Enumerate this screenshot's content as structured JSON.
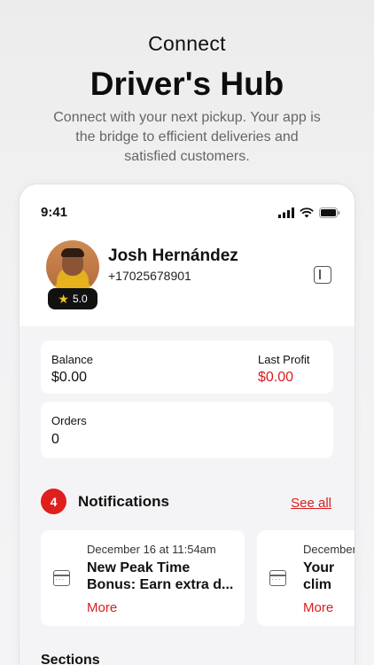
{
  "promo": {
    "eyebrow": "Connect",
    "title": "Driver's Hub",
    "subtitle": "Connect with your next pickup. Your app is the bridge to efficient deliveries and satisfied customers."
  },
  "status_bar": {
    "time": "9:41"
  },
  "profile": {
    "name": "Josh Hernández",
    "phone": "+17025678901",
    "rating": "5.0"
  },
  "stats": {
    "balance_label": "Balance",
    "balance_value": "$0.00",
    "last_profit_label": "Last Profit",
    "last_profit_value": "$0.00",
    "orders_label": "Orders",
    "orders_value": "0"
  },
  "notifications": {
    "count": "4",
    "title": "Notifications",
    "see_all": "See all",
    "items": [
      {
        "date": "December 16 at 11:54am",
        "title_line1": "New Peak Time",
        "title_line2": "Bonus: Earn extra d...",
        "more": "More"
      },
      {
        "date": "December",
        "title_line1": "Your",
        "title_line2": "clim",
        "more": "More"
      }
    ]
  },
  "sections": {
    "title": "Sections"
  },
  "colors": {
    "accent": "#d91d1d",
    "badge": "#e01e1e",
    "star": "#f6c21a"
  }
}
